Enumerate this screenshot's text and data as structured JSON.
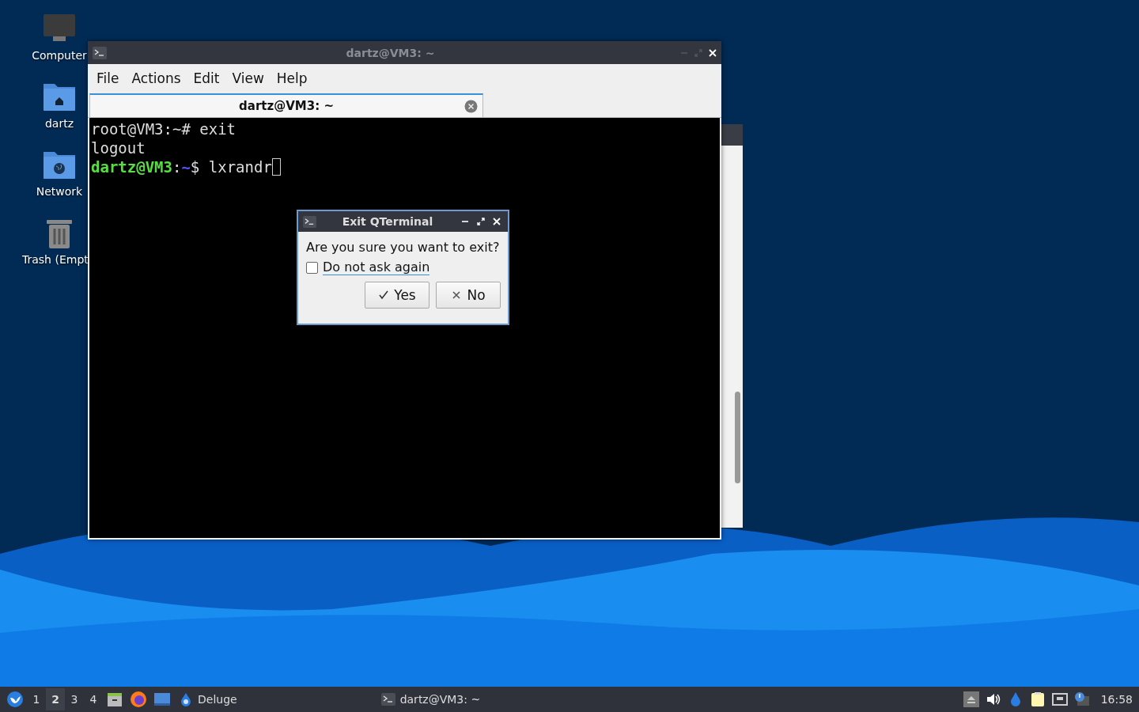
{
  "desktop_icons": [
    {
      "kind": "computer",
      "label": "Computer"
    },
    {
      "kind": "home",
      "label": "dartz"
    },
    {
      "kind": "network",
      "label": "Network"
    },
    {
      "kind": "trash",
      "label": "Trash (Empt"
    }
  ],
  "terminal_window": {
    "title": "dartz@VM3: ~",
    "menu": [
      "File",
      "Actions",
      "Edit",
      "View",
      "Help"
    ],
    "tabs": [
      {
        "label": "dartz@VM3: ~",
        "selected": true
      }
    ],
    "lines": [
      {
        "kind": "plain",
        "text": "root@VM3:~# exit"
      },
      {
        "kind": "plain",
        "text": "logout"
      },
      {
        "kind": "prompt",
        "user_host": "dartz@VM3",
        "separator": ":",
        "path": "~",
        "symbol": "$",
        "command": "lxrandr"
      }
    ]
  },
  "dialog": {
    "title": "Exit QTerminal",
    "message": "Are you sure you want to exit?",
    "checkbox": {
      "label": "Do not ask again",
      "checked": false
    },
    "buttons": [
      {
        "kind": "yes",
        "label": "Yes"
      },
      {
        "kind": "no",
        "label": "No"
      }
    ]
  },
  "taskbar": {
    "workspaces": [
      {
        "label": "1",
        "selected": false
      },
      {
        "label": "2",
        "selected": true
      },
      {
        "label": "3",
        "selected": false
      },
      {
        "label": "4",
        "selected": false
      }
    ],
    "tasks": [
      {
        "kind": "deluge",
        "label": "Deluge"
      },
      {
        "kind": "terminal",
        "label": "dartz@VM3: ~"
      }
    ],
    "clock": "16:58"
  }
}
